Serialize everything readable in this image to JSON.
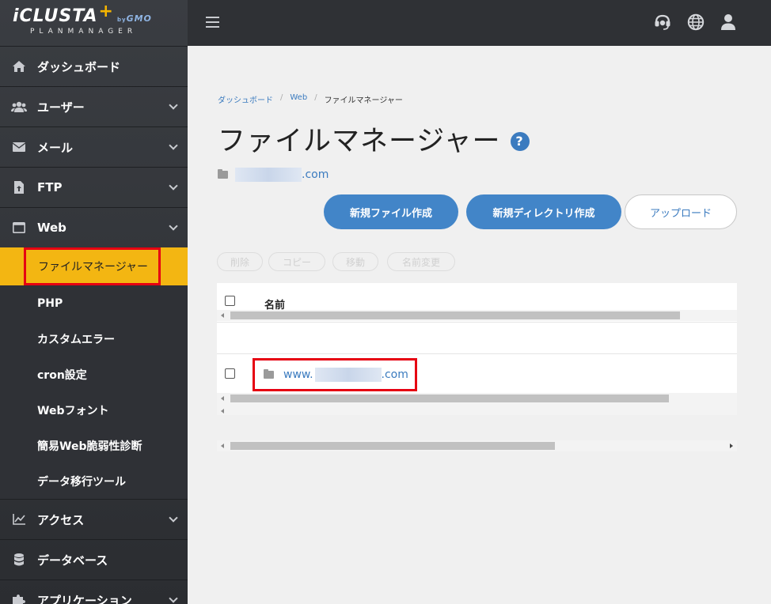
{
  "logo": {
    "main": "iCLUSTA",
    "plus": "+",
    "by": "by",
    "gmo": "GMO",
    "sub": "PLANMANAGER"
  },
  "sidebar": {
    "items": [
      {
        "label": "ダッシュボード",
        "icon": "home-icon"
      },
      {
        "label": "ユーザー",
        "icon": "users-icon"
      },
      {
        "label": "メール",
        "icon": "mail-icon"
      },
      {
        "label": "FTP",
        "icon": "file-upload-icon"
      },
      {
        "label": "Web",
        "icon": "window-icon"
      },
      {
        "label": "アクセス",
        "icon": "chart-icon"
      },
      {
        "label": "データベース",
        "icon": "database-icon"
      },
      {
        "label": "アプリケーション",
        "icon": "puzzle-icon"
      }
    ],
    "web_sub": [
      {
        "label": "ファイルマネージャー",
        "active": true
      },
      {
        "label": "PHP"
      },
      {
        "label": "カスタムエラー"
      },
      {
        "label": "cron設定"
      },
      {
        "label": "Webフォント"
      },
      {
        "label": "簡易Web脆弱性診断"
      },
      {
        "label": "データ移行ツール"
      }
    ]
  },
  "topbar": {
    "icons": [
      "menu-icon",
      "support-icon",
      "globe-icon",
      "user-icon"
    ]
  },
  "breadcrumb": [
    {
      "label": "ダッシュボード"
    },
    {
      "label": "Web"
    },
    {
      "label": "ファイルマネージャー"
    }
  ],
  "page": {
    "title": "ファイルマネージャー",
    "help": "?"
  },
  "path": {
    "suffix": ".com"
  },
  "actions": {
    "new_file": "新規ファイル作成",
    "new_dir": "新規ディレクトリ作成",
    "upload": "アップロード",
    "delete": "削除",
    "copy": "コピー",
    "move": "移動",
    "rename": "名前変更"
  },
  "table": {
    "header": "名前",
    "rows": [
      {
        "prefix": "www.",
        "suffix": ".com"
      }
    ]
  },
  "colors": {
    "accent": "#4285c8",
    "highlight": "#f3b612",
    "annotation": "#e60012"
  }
}
